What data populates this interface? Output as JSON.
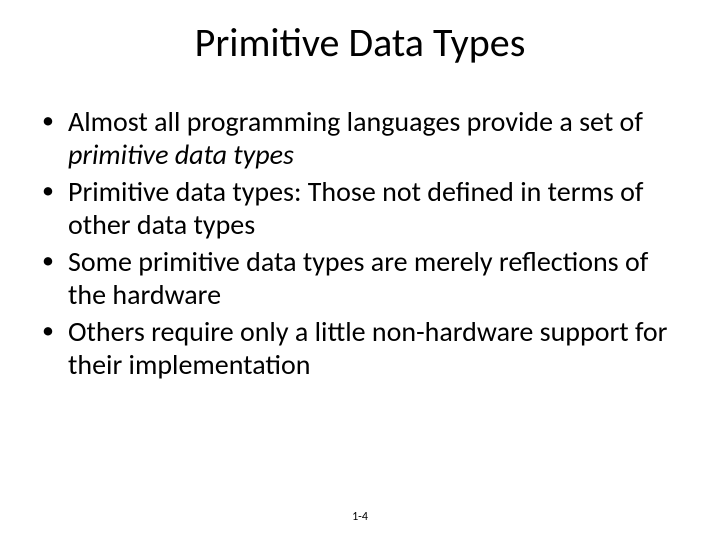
{
  "title": "Primitive Data Types",
  "bullets": [
    {
      "pre": "Almost all programming languages provide a set of ",
      "em": "primitive data types",
      "post": ""
    },
    {
      "pre": "Primitive data types: Those not defined in terms of other data types",
      "em": "",
      "post": ""
    },
    {
      "pre": "Some primitive data types are merely reflections of the hardware",
      "em": "",
      "post": ""
    },
    {
      "pre": "Others require only a little non-hardware support for their implementation",
      "em": "",
      "post": ""
    }
  ],
  "footer": "1-4"
}
